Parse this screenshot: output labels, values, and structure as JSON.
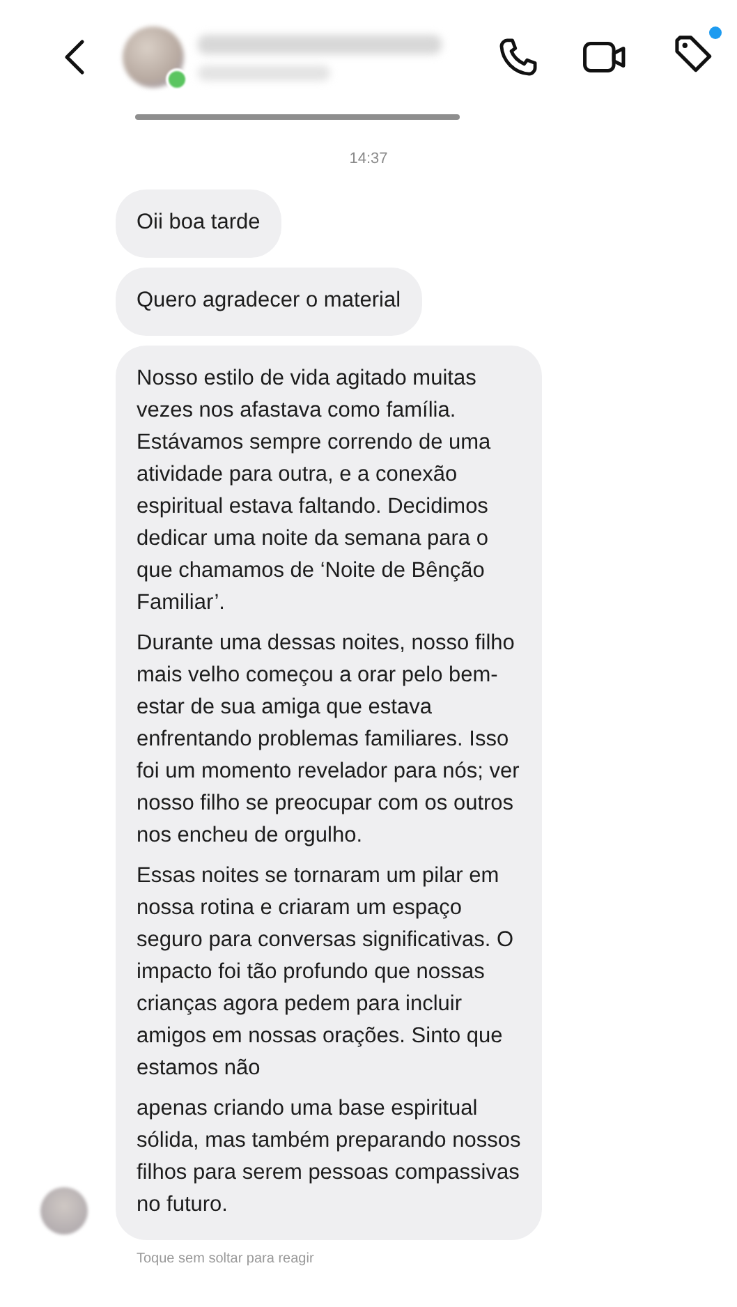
{
  "header": {
    "contact_online": true,
    "tag_notification": true
  },
  "timestamp": "14:37",
  "messages": [
    {
      "paragraphs": [
        "Oii boa tarde"
      ]
    },
    {
      "paragraphs": [
        "Quero agradecer o material"
      ]
    },
    {
      "paragraphs": [
        "Nosso estilo de vida agitado muitas\nvezes nos afastava como família.\nEstávamos sempre correndo de uma\natividade para outra, e a conexão\nespiritual estava faltando. Decidimos\ndedicar uma noite da semana para o\nque chamamos de ‘Noite de Bênção\nFamiliar’.",
        "Durante uma dessas noites, nosso filho\nmais velho começou a orar pelo bem-\nestar de sua amiga que estava\nenfrentando problemas familiares. Isso\nfoi um momento revelador para nós; ver\nnosso filho se preocupar com os outros\nnos encheu de orgulho.",
        "Essas noites se tornaram um pilar em\nnossa rotina e criaram um espaço\nseguro para conversas significativas. O\nimpacto foi tão profundo que nossas\ncrianças agora pedem para incluir\namigos em nossas orações. Sinto que\nestamos não",
        "apenas criando uma base espiritual\nsólida, mas também preparando nossos\nfilhos para serem pessoas compassivas\nno futuro."
      ]
    }
  ],
  "reaction_hint": "Toque sem soltar para reagir"
}
